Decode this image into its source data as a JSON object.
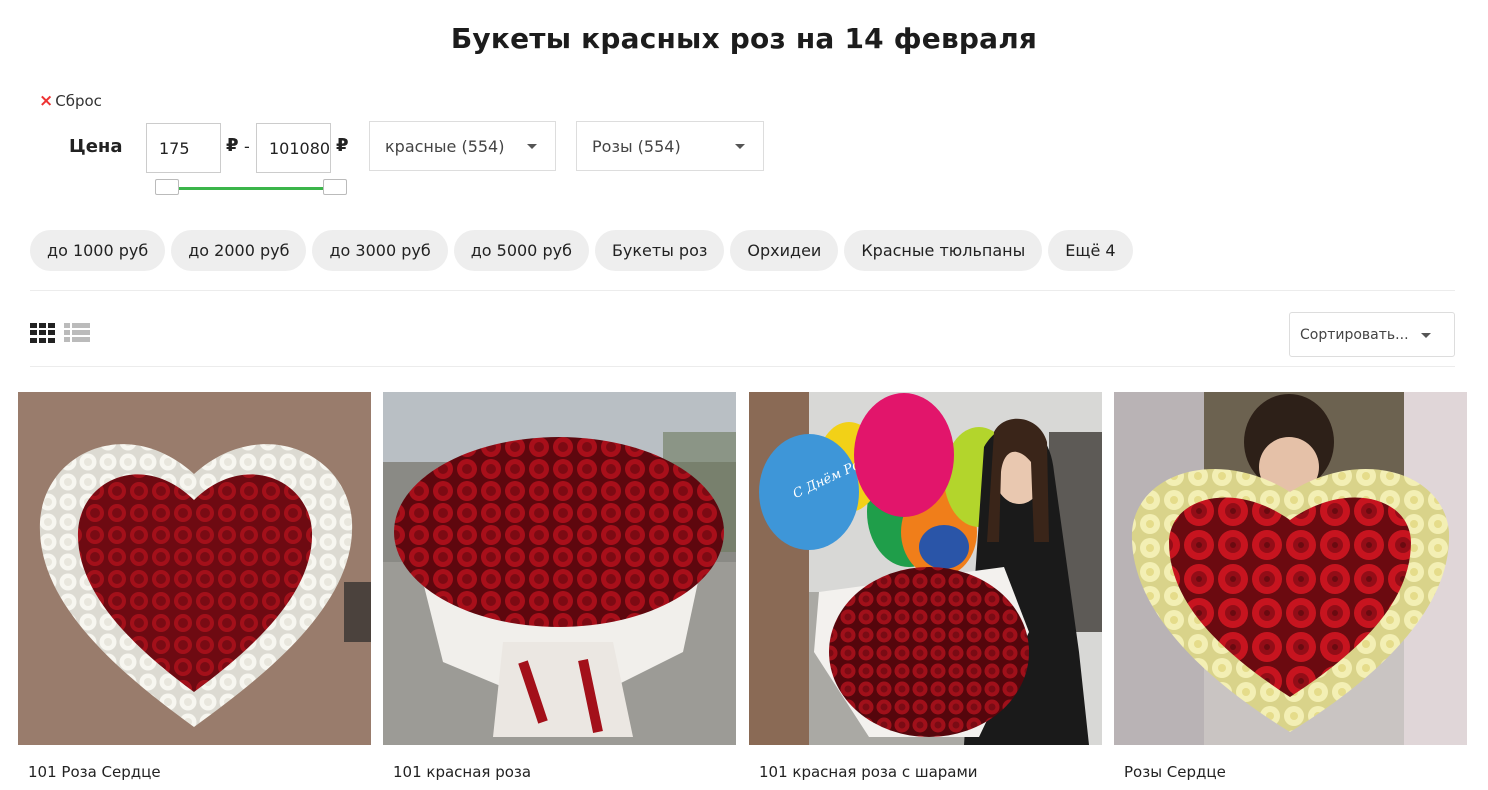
{
  "page": {
    "title": "Букеты красных роз на 14 февраля"
  },
  "filters": {
    "reset_label": "Сброс",
    "price_label": "Цена",
    "price_from": "175",
    "price_to": "101080",
    "currency": "₽",
    "separator": "-",
    "color_select": "красные (554)",
    "flower_select": "Розы (554)"
  },
  "chips": [
    "до 1000 руб",
    "до 2000 руб",
    "до 3000 руб",
    "до 5000 руб",
    "Букеты роз",
    "Орхидеи",
    "Красные тюльпаны",
    "Ещё 4"
  ],
  "toolbar": {
    "sort_label": "Сортировать...",
    "view_grid_icon": "grid-view-icon",
    "view_list_icon": "list-view-icon"
  },
  "products": [
    {
      "name": "101 Роза Сердце"
    },
    {
      "name": "101 красная роза"
    },
    {
      "name": "101 красная роза с шарами"
    },
    {
      "name": "Розы Сердце"
    }
  ],
  "image_text": {
    "balloon": "С Днём Рождения"
  },
  "colors": {
    "accent_green": "#3bb54a",
    "reset_red": "#ee3333",
    "chip_bg": "#eeeeee",
    "rose_red": "#a3101a"
  }
}
